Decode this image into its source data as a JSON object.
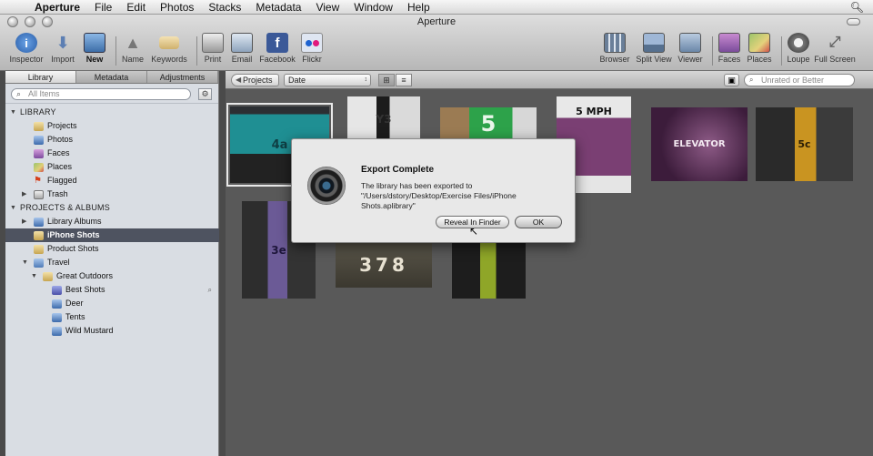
{
  "menubar": {
    "app": "Aperture",
    "items": [
      "File",
      "Edit",
      "Photos",
      "Stacks",
      "Metadata",
      "View",
      "Window",
      "Help"
    ]
  },
  "window": {
    "title": "Aperture"
  },
  "toolbar": {
    "inspector": "Inspector",
    "import": "Import",
    "new": "New",
    "name": "Name",
    "keywords": "Keywords",
    "print": "Print",
    "email": "Email",
    "facebook": "Facebook",
    "flickr": "Flickr",
    "browser": "Browser",
    "split_view": "Split View",
    "viewer": "Viewer",
    "faces": "Faces",
    "places": "Places",
    "loupe": "Loupe",
    "full_screen": "Full Screen"
  },
  "sidebar": {
    "tabs": [
      "Library",
      "Metadata",
      "Adjustments"
    ],
    "search_placeholder": "All Items",
    "library_header": "LIBRARY",
    "library_items": [
      "Projects",
      "Photos",
      "Faces",
      "Places",
      "Flagged",
      "Trash"
    ],
    "projects_header": "PROJECTS & ALBUMS",
    "library_albums": "Library Albums",
    "iphone_shots": "iPhone Shots",
    "product_shots": "Product Shots",
    "travel": "Travel",
    "great_outdoors": "Great Outdoors",
    "albums": [
      "Best Shots",
      "Deer",
      "Tents",
      "Wild Mustard"
    ]
  },
  "browser_bar": {
    "crumb": "Projects",
    "sort": "Date",
    "filter_placeholder": "Unrated or Better"
  },
  "thumbnails": [
    {
      "label": "4a",
      "bg": "#1f8f93"
    },
    {
      "label": "Y3",
      "bg": "#cfcfcf"
    },
    {
      "label": "5",
      "bg": "#2da24a"
    },
    {
      "label": "5 MPH",
      "bg": "#7a3f73"
    },
    {
      "label": "ELEVATOR",
      "bg": "#5a2c59"
    },
    {
      "label": "5c",
      "bg": "#c99421"
    },
    {
      "label": "3e",
      "bg": "#6b5a96"
    },
    {
      "label": "378",
      "bg": "#4d4a40"
    },
    {
      "label": "",
      "bg": "#8fa628"
    }
  ],
  "dialog": {
    "title": "Export Complete",
    "message": "The library has been exported to \"/Users/dstory/Desktop/Exercise Files/iPhone Shots.aplibrary\"",
    "reveal_label": "Reveal In Finder",
    "ok_label": "OK"
  }
}
